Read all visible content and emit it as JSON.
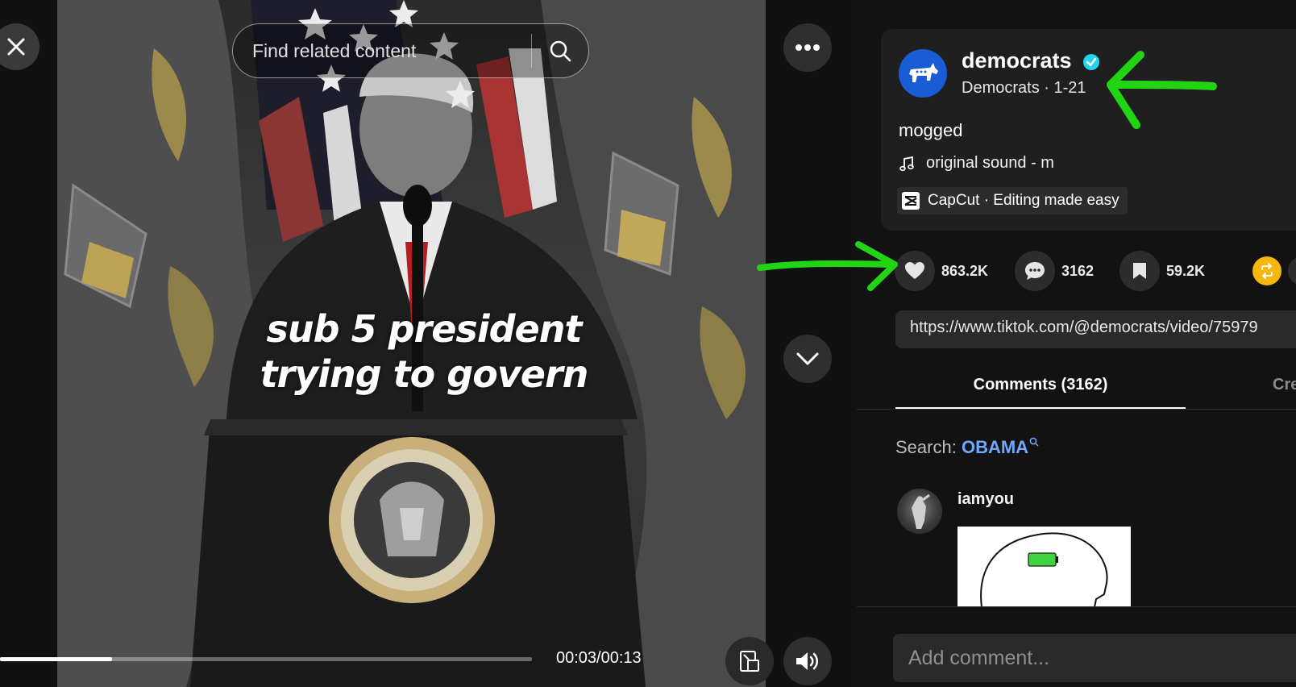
{
  "video": {
    "caption_line1": "sub 5 president",
    "caption_line2": "trying to govern",
    "search_placeholder": "Find related content",
    "time": "00:03/00:13",
    "progress": 0.21
  },
  "author": {
    "username": "democrats",
    "display_name": "Democrats",
    "date": "1-21",
    "verified": true
  },
  "post": {
    "description": "mogged",
    "sound": "original sound - m",
    "capcut": "CapCut · Editing made easy"
  },
  "stats": {
    "likes": "863.2K",
    "comments": "3162",
    "saves": "59.2K"
  },
  "link": "https://www.tiktok.com/@democrats/video/75979",
  "tabs": {
    "comments": "Comments (3162)",
    "creator": "Cre"
  },
  "search_suggest": {
    "label": "Search:",
    "term": "OBAMA"
  },
  "comment": {
    "username": "iamyou"
  },
  "comment_input_placeholder": "Add comment...",
  "colors": {
    "accent_blue": "#6fa8ff",
    "verified": "#20d5ec",
    "annotation_green": "#22d514",
    "share_yellow": "#f6b60a"
  }
}
